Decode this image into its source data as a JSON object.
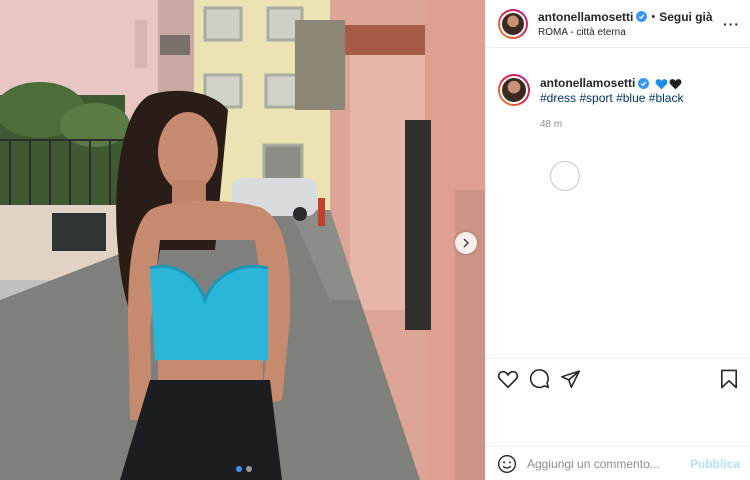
{
  "post": {
    "username": "antonellamosetti",
    "separator": "•",
    "follow_label": "Segui già",
    "location": "ROMA - città eterna",
    "more_label": "···"
  },
  "caption": {
    "username": "antonellamosetti",
    "hearts": [
      "blue-heart",
      "black-heart"
    ],
    "hashtags": [
      "#dress",
      "#sport",
      "#blue",
      "#black"
    ],
    "time": "48 m"
  },
  "actions": [
    "heart-icon",
    "comment-icon",
    "share-icon",
    "bookmark-icon"
  ],
  "comment_bar": {
    "placeholder": "Aggiungi un commento...",
    "publish_label": "Pubblica"
  },
  "carousel": {
    "current": 1,
    "total": 2
  },
  "colors": {
    "verified": "#3897f0",
    "link": "#00376b",
    "publish_disabled": "#b2dffc",
    "top": "#29b6d9"
  }
}
